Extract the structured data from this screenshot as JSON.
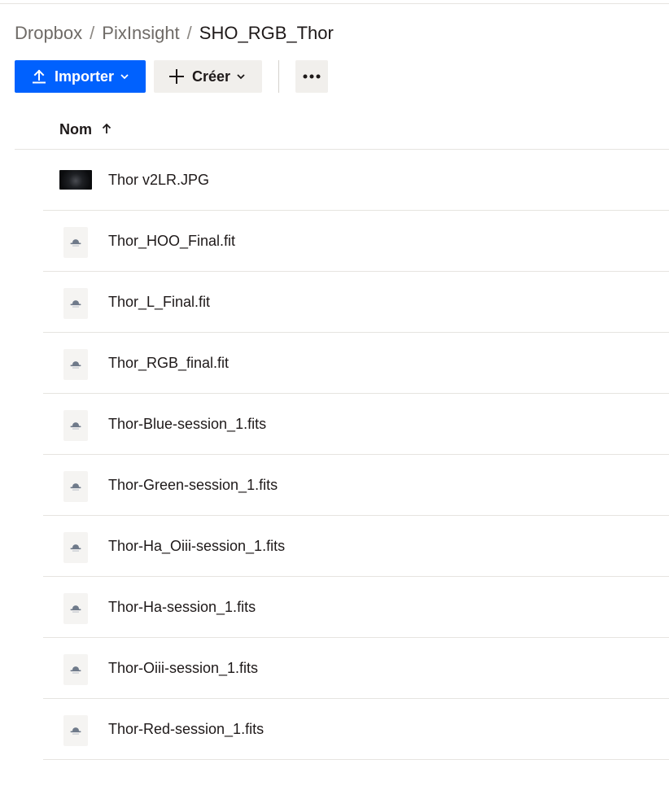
{
  "breadcrumb": {
    "items": [
      "Dropbox",
      "PixInsight"
    ],
    "current": "SHO_RGB_Thor",
    "separator": "/"
  },
  "toolbar": {
    "import_label": "Importer",
    "create_label": "Créer",
    "primary_color": "#0061fe"
  },
  "table": {
    "name_header": "Nom",
    "sort": "ascending"
  },
  "files": [
    {
      "name": "Thor v2LR.JPG",
      "icon": "image-thumbnail"
    },
    {
      "name": "Thor_HOO_Final.fit",
      "icon": "generic-file-icon"
    },
    {
      "name": "Thor_L_Final.fit",
      "icon": "generic-file-icon"
    },
    {
      "name": "Thor_RGB_final.fit",
      "icon": "generic-file-icon"
    },
    {
      "name": "Thor-Blue-session_1.fits",
      "icon": "generic-file-icon"
    },
    {
      "name": "Thor-Green-session_1.fits",
      "icon": "generic-file-icon"
    },
    {
      "name": "Thor-Ha_Oiii-session_1.fits",
      "icon": "generic-file-icon"
    },
    {
      "name": "Thor-Ha-session_1.fits",
      "icon": "generic-file-icon"
    },
    {
      "name": "Thor-Oiii-session_1.fits",
      "icon": "generic-file-icon"
    },
    {
      "name": "Thor-Red-session_1.fits",
      "icon": "generic-file-icon"
    }
  ]
}
